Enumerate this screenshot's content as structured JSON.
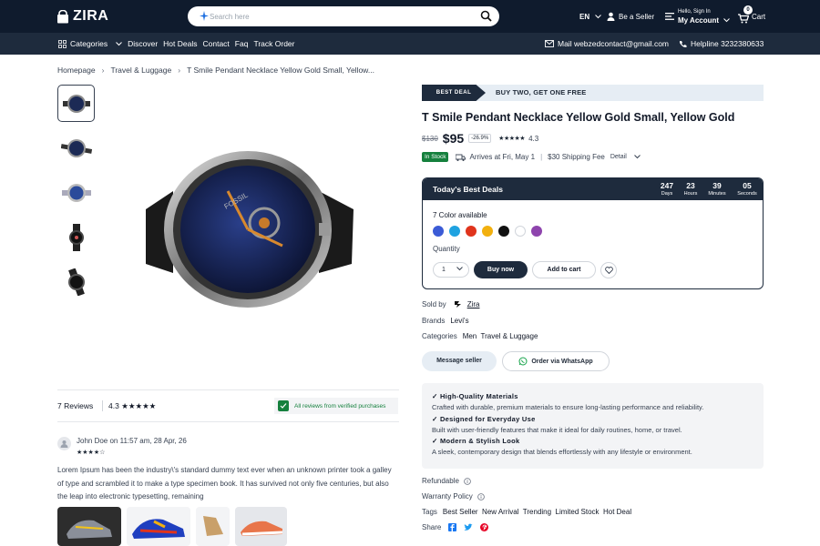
{
  "header": {
    "logo": "ZIRA",
    "search_placeholder": "Search here",
    "lang": "EN",
    "seller": "Be a Seller",
    "account_small": "Hello, Sign In",
    "account_big": "My Account",
    "cart_count": "0",
    "cart": "Cart"
  },
  "nav": {
    "categories": "Categories",
    "items": [
      "Discover",
      "Hot Deals",
      "Contact",
      "Faq",
      "Track Order"
    ],
    "mail": "Mail webzedcontact@gmail.com",
    "helpline": "Helpline 3232380633"
  },
  "breadcrumb": [
    "Homepage",
    "Travel & Luggage",
    "T Smile Pendant Necklace Yellow Gold Small, Yellow..."
  ],
  "deal": {
    "tag": "BEST DEAL",
    "text": "BUY TWO, GET ONE FREE"
  },
  "product": {
    "title": "T Smile Pendant Necklace Yellow Gold Small, Yellow Gold",
    "old_price": "$130",
    "price": "$95",
    "discount": "-26.9%",
    "stars": "★★★★★",
    "rating": "4.3",
    "stock": "In Stock",
    "arrives": "Arrives at Fri, May 1",
    "shipping": "$30 Shipping Fee",
    "detail": "Detail"
  },
  "deals_box": {
    "title": "Today's Best Deals",
    "countdown": [
      {
        "n": "247",
        "l": "Days"
      },
      {
        "n": "23",
        "l": "Hours"
      },
      {
        "n": "39",
        "l": "Minutes"
      },
      {
        "n": "05",
        "l": "Seconds"
      }
    ],
    "colors_label": "7 Color available",
    "colors": [
      "#3b5bd6",
      "#1fa2e0",
      "#e0341c",
      "#f2b00f",
      "#111111",
      "#ffffff",
      "#8e44ad"
    ],
    "qty_label": "Quantity",
    "qty_value": "1",
    "buy_now": "Buy now",
    "add_to_cart": "Add to cart"
  },
  "meta": {
    "sold_by_label": "Sold by",
    "sold_by": "Zira",
    "brands_label": "Brands",
    "brands": "Levi's",
    "categories_label": "Categories",
    "categories": "Men  Travel & Luggage"
  },
  "buttons": {
    "message": "Message seller",
    "whatsapp": "Order via WhatsApp"
  },
  "features": [
    {
      "h": "✓ High-Quality Materials",
      "d": "Crafted with durable, premium materials to ensure long-lasting performance and reliability."
    },
    {
      "h": "✓ Designed for Everyday Use",
      "d": "Built with user-friendly features that make it ideal for daily routines, home, or travel."
    },
    {
      "h": "✓ Modern & Stylish Look",
      "d": "A sleek, contemporary design that blends effortlessly with any lifestyle or environment."
    }
  ],
  "policies": {
    "refundable": "Refundable",
    "warranty": "Warranty Policy"
  },
  "tags": {
    "label": "Tags",
    "items": "Best Seller  New Arrival  Trending  Limited Stock  Hot Deal"
  },
  "share": "Share",
  "reviews": {
    "count": "7 Reviews",
    "avg": "4.3",
    "avg_stars": "★★★★★",
    "verified": "All reviews from verified purchases",
    "author": "John Doe on 11:57 am, 28 Apr, 26",
    "stars": "★★★★☆",
    "text": "Lorem Ipsum has been the industry\\'s standard dummy text ever when an unknown printer took a galley of type and scrambled it to make a type specimen book. It has survived not only five centuries, but also the leap into electronic typesetting, remaining"
  }
}
